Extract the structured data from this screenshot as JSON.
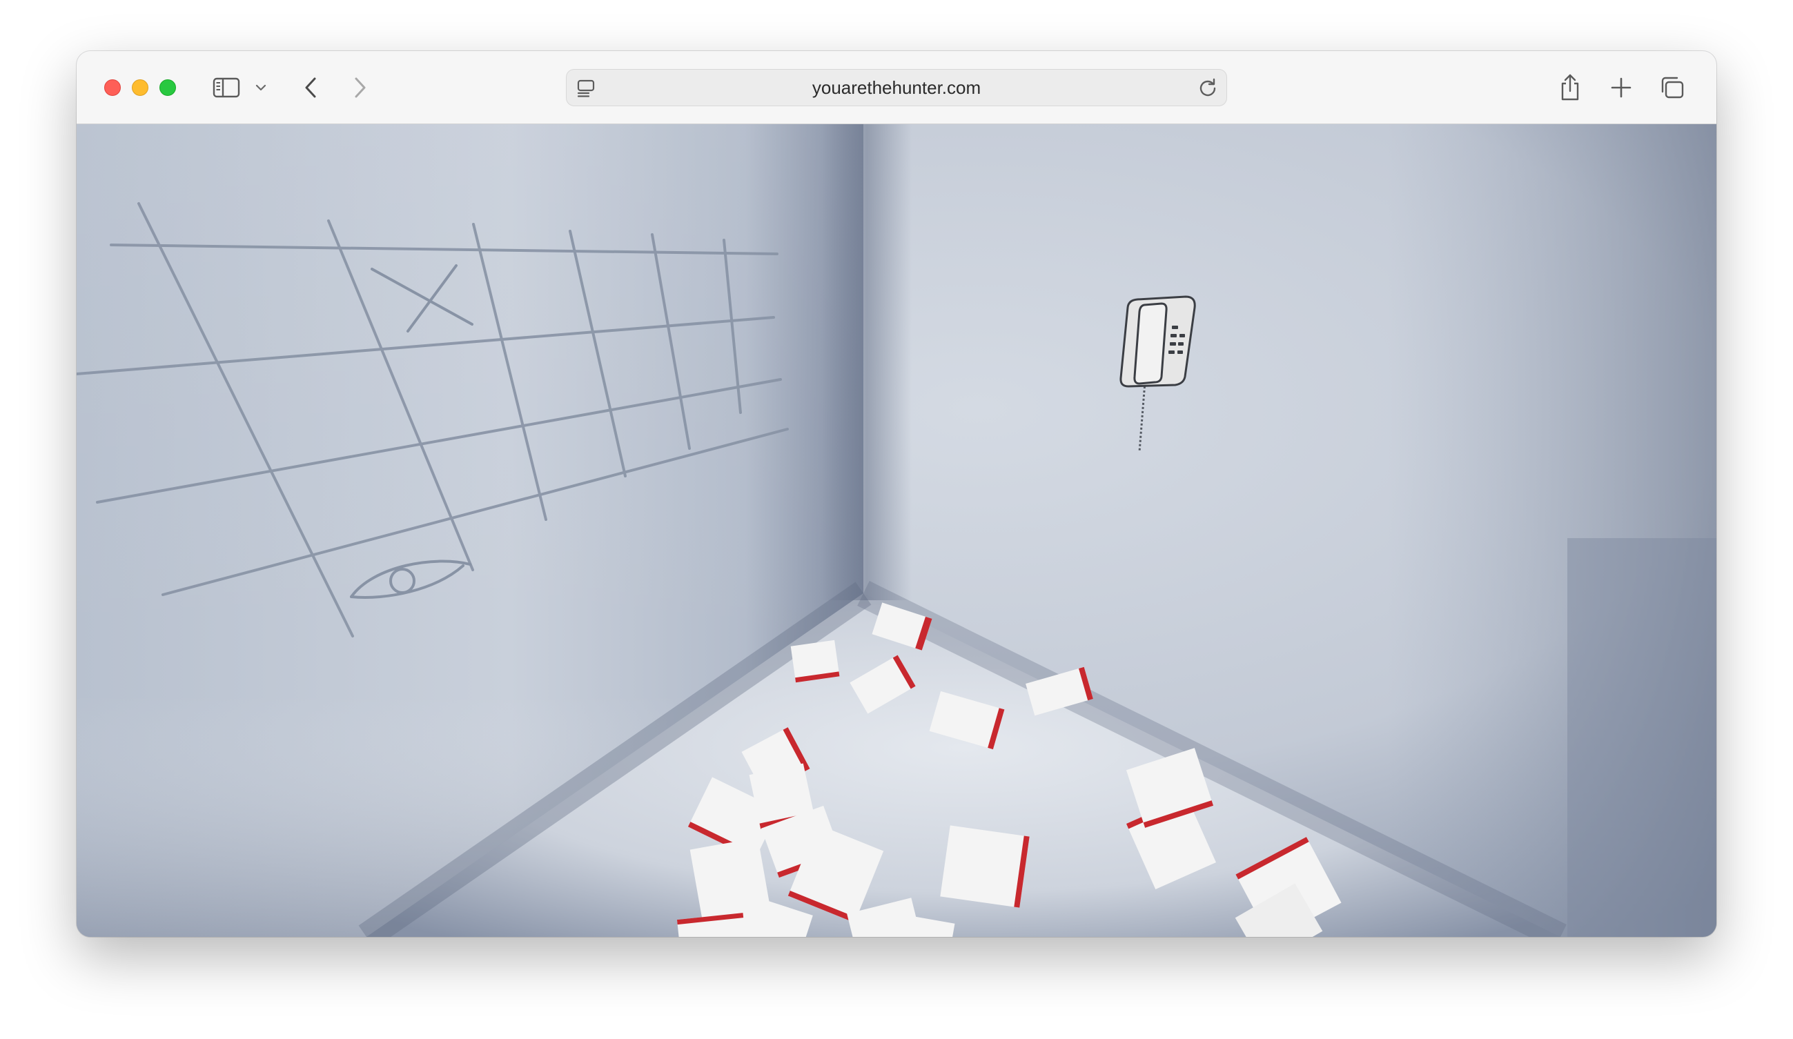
{
  "browser": {
    "url": "youarethehunter.com",
    "icons": {
      "close": "close-window-icon",
      "minimize": "minimize-window-icon",
      "zoom": "zoom-window-icon",
      "sidebar": "sidebar-icon",
      "sidebar_menu": "chevron-down-icon",
      "back": "back-arrow-icon",
      "forward": "forward-arrow-icon",
      "site": "site-info-icon",
      "reload": "reload-icon",
      "share": "share-icon",
      "new_tab": "plus-icon",
      "tab_overview": "tab-overview-icon"
    },
    "colors": {
      "close": "#fe5f57",
      "minimize": "#febc2e",
      "zoom": "#28c840"
    }
  },
  "scene": {
    "description_icons": [
      "wall-grid-drawing",
      "eye-drawing",
      "x-mark-drawing",
      "wall-phone",
      "scattered-papers"
    ],
    "colors": {
      "wall_light": "#ccd3de",
      "wall_dark": "#8c97aa",
      "floor": "#d9dee6",
      "paper": "#f4f4f4",
      "paper_stripe": "#c8282e"
    }
  }
}
